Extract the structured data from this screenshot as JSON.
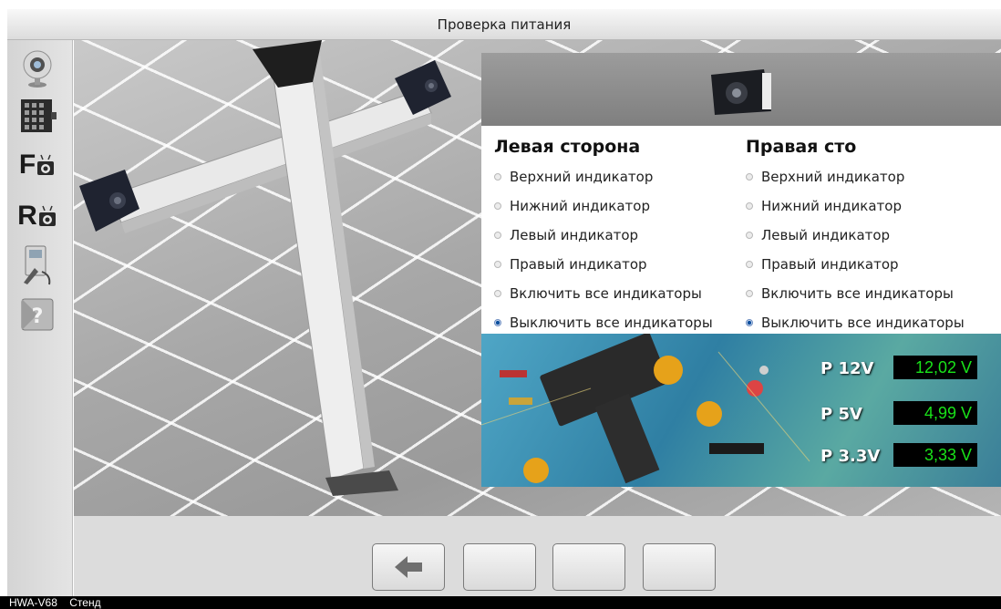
{
  "window": {
    "title": "Проверка питания"
  },
  "sidebar": {
    "items": [
      {
        "icon": "camera-sensor-icon"
      },
      {
        "icon": "target-board-icon"
      },
      {
        "icon": "front-camera-icon",
        "letter": "F"
      },
      {
        "icon": "rear-camera-icon",
        "letter": "R"
      },
      {
        "icon": "diagnostics-tool-icon"
      },
      {
        "icon": "help-icon"
      }
    ]
  },
  "panel": {
    "left": {
      "title": "Левая сторона",
      "options": [
        {
          "label": "Верхний индикатор",
          "selected": false
        },
        {
          "label": "Нижний индикатор",
          "selected": false
        },
        {
          "label": "Левый индикатор",
          "selected": false
        },
        {
          "label": "Правый  индикатор",
          "selected": false
        },
        {
          "label": "Включить все индикаторы",
          "selected": false
        },
        {
          "label": "Выключить все индикаторы",
          "selected": true
        }
      ]
    },
    "right": {
      "title": "Правая сто",
      "options": [
        {
          "label": "Верхний индикатор",
          "selected": false
        },
        {
          "label": "Нижний индикатор",
          "selected": false
        },
        {
          "label": "Левый индикатор",
          "selected": false
        },
        {
          "label": "Правый  индикатор",
          "selected": false
        },
        {
          "label": "Включить все индикаторы",
          "selected": false
        },
        {
          "label": "Выключить все индикаторы",
          "selected": true
        }
      ]
    },
    "readouts": [
      {
        "label": "P 12V",
        "value": "12,02 V"
      },
      {
        "label": "P  5V",
        "value": "4,99 V"
      },
      {
        "label": "P 3.3V",
        "value": "3,33 V"
      }
    ]
  },
  "bottom": {
    "buttons": [
      {
        "icon": "back-arrow-icon"
      },
      {
        "icon": ""
      },
      {
        "icon": ""
      },
      {
        "icon": ""
      }
    ]
  },
  "status": {
    "device": "HWA-V68",
    "mode": "Стенд"
  },
  "colors": {
    "readout_text": "#19e219",
    "selected_radio": "#0b4f9e"
  }
}
